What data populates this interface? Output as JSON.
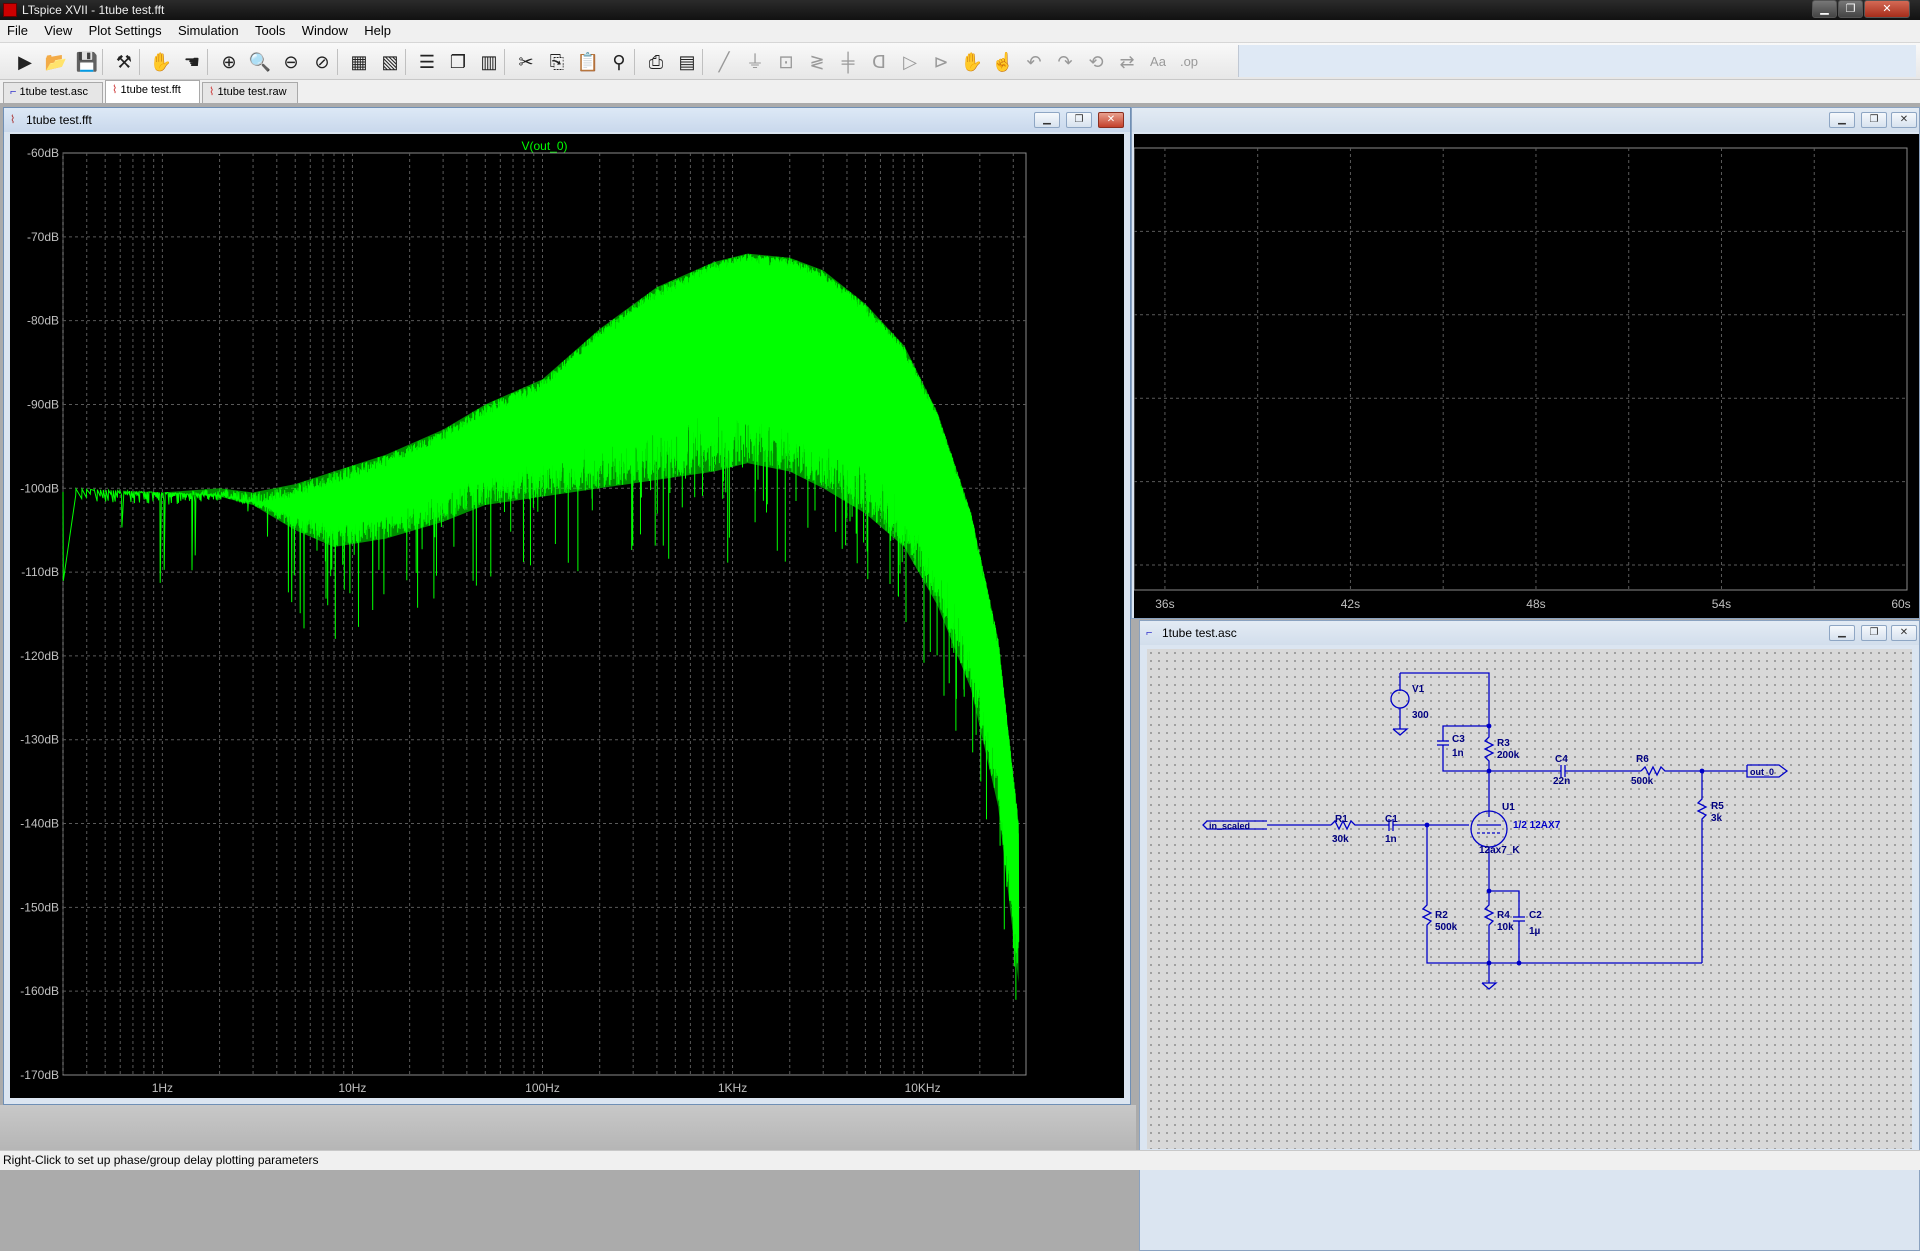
{
  "window": {
    "title": "LTspice XVII - 1tube test.fft"
  },
  "menu": [
    "File",
    "View",
    "Plot Settings",
    "Simulation",
    "Tools",
    "Window",
    "Help"
  ],
  "toolbar_icons": [
    "run-icon",
    "open-icon",
    "save-icon",
    "control-panel-icon",
    "halt-icon",
    "pan-icon",
    "zoom-in-icon",
    "zoom-area-icon",
    "zoom-out-icon",
    "zoom-cancel-icon",
    "autorange-icon",
    "manual-limits-icon",
    "tile-horizontal-icon",
    "cascade-icon",
    "tile-vertical-icon",
    "cut-icon",
    "copy-icon",
    "paste-icon",
    "find-icon",
    "print-icon",
    "print-setup-icon",
    "wire-icon",
    "ground-icon",
    "label-net-icon",
    "resistor-icon",
    "capacitor-icon",
    "inductor-icon",
    "diode-icon",
    "component-icon",
    "move-icon",
    "drag-icon",
    "undo-icon",
    "redo-icon",
    "rotate-icon",
    "mirror-icon",
    "text-icon",
    "spice-directive-icon"
  ],
  "tabs": [
    {
      "label": "1tube test.asc",
      "active": false
    },
    {
      "label": "1tube test.fft",
      "active": true
    },
    {
      "label": "1tube test.raw",
      "active": false
    }
  ],
  "fft_window": {
    "title": "1tube test.fft"
  },
  "raw_window": {
    "title": ""
  },
  "asc_window": {
    "title": "1tube test.asc"
  },
  "chart_data": [
    {
      "type": "line",
      "title": "V(out_0)",
      "xscale": "log",
      "xlim": [
        0.3,
        35000
      ],
      "ylim": [
        -170,
        -60
      ],
      "y_ticks": [
        "-60dB",
        "-70dB",
        "-80dB",
        "-90dB",
        "-100dB",
        "-110dB",
        "-120dB",
        "-130dB",
        "-140dB",
        "-150dB",
        "-160dB",
        "-170dB"
      ],
      "x_ticks": [
        "1Hz",
        "10Hz",
        "100Hz",
        "1KHz",
        "10KHz"
      ],
      "grid": true,
      "series": [
        {
          "name": "V(out_0)",
          "color": "#00ff00",
          "x": [
            0.3,
            1,
            2,
            3,
            5,
            8,
            15,
            30,
            50,
            100,
            200,
            400,
            800,
            1200,
            2000,
            3000,
            5000,
            8000,
            12000,
            18000,
            25000,
            32000
          ],
          "y": [
            -100,
            -100.5,
            -100,
            -100.5,
            -99.5,
            -98,
            -96,
            -93,
            -90,
            -87,
            -81,
            -76,
            -73,
            -72,
            -72.5,
            -74,
            -78,
            -83,
            -91,
            -103,
            -118,
            -140
          ],
          "y_low": [
            -100,
            -100.5,
            -101,
            -102,
            -105,
            -107,
            -106,
            -104,
            -102,
            -101,
            -100,
            -99,
            -98,
            -97,
            -98,
            -100,
            -103,
            -107,
            -114,
            -124,
            -138,
            -159
          ]
        }
      ]
    },
    {
      "type": "line",
      "title": "",
      "x_ticks": [
        "36s",
        "42s",
        "48s",
        "54s",
        "60s"
      ],
      "xlim": [
        35,
        60
      ],
      "grid": true,
      "series": []
    }
  ],
  "schematic": {
    "labels": {
      "V1": "V1",
      "V1_val": "300",
      "C3": "C3",
      "C3_val": "1n",
      "R3": "R3",
      "R3_val": "200k",
      "C4": "C4",
      "C4_val": "22n",
      "R6": "R6",
      "R6_val": "500k",
      "R5": "R5",
      "R5_val": "3k",
      "R1": "R1",
      "R1_val": "30k",
      "C1": "C1",
      "C1_val": "1n",
      "U1": "U1",
      "U1_part": "1/2 12AX7",
      "U1_model": "12ax7_K",
      "R2": "R2",
      "R2_val": "500k",
      "R4": "R4",
      "R4_val": "10k",
      "C2": "C2",
      "C2_val": "1µ",
      "in_label": "in_scaled",
      "out_label": "out_0"
    },
    "wire_color": "#0000c8",
    "text_color": "#000080"
  },
  "status": "Right-Click to set up phase/group delay plotting parameters"
}
